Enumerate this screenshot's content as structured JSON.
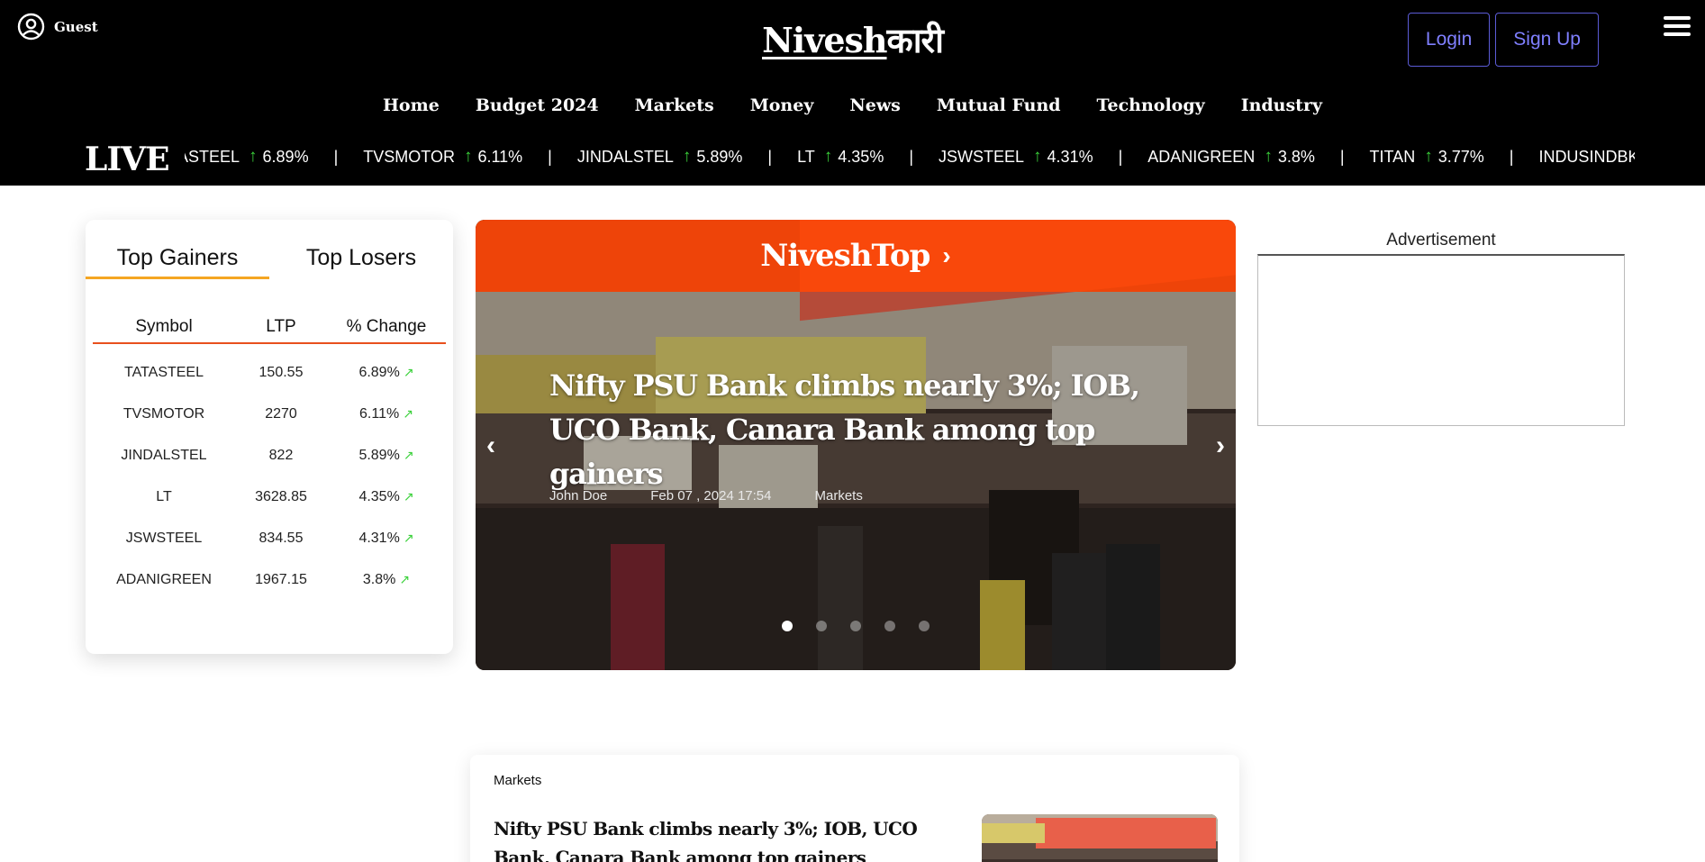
{
  "header": {
    "guest_label": "Guest",
    "logo_latin": "Nivesh",
    "logo_devanagari": "कारी",
    "login_label": "Login",
    "signup_label": "Sign Up"
  },
  "nav": {
    "items": [
      "Home",
      "Budget 2024",
      "Markets",
      "Money",
      "News",
      "Mutual Fund",
      "Technology",
      "Industry"
    ]
  },
  "ticker": {
    "live_label": "LIVE",
    "items": [
      {
        "symbol": "ASTEEL",
        "change": "6.89%"
      },
      {
        "symbol": "TVSMOTOR",
        "change": "6.11%"
      },
      {
        "symbol": "JINDALSTEL",
        "change": "5.89%"
      },
      {
        "symbol": "LT",
        "change": "4.35%"
      },
      {
        "symbol": "JSWSTEEL",
        "change": "4.31%"
      },
      {
        "symbol": "ADANIGREEN",
        "change": "3.8%"
      },
      {
        "symbol": "TITAN",
        "change": "3.77%"
      },
      {
        "symbol": "INDUSINDBK",
        "change": ""
      }
    ],
    "separator": "|"
  },
  "gainers_card": {
    "tab_gainers": "Top Gainers",
    "tab_losers": "Top Losers",
    "headers": [
      "Symbol",
      "LTP",
      "% Change"
    ],
    "rows": [
      {
        "symbol": "TATASTEEL",
        "ltp": "150.55",
        "change": "6.89%"
      },
      {
        "symbol": "TVSMOTOR",
        "ltp": "2270",
        "change": "6.11%"
      },
      {
        "symbol": "JINDALSTEL",
        "ltp": "822",
        "change": "5.89%"
      },
      {
        "symbol": "LT",
        "ltp": "3628.85",
        "change": "4.35%"
      },
      {
        "symbol": "JSWSTEEL",
        "ltp": "834.55",
        "change": "4.31%"
      },
      {
        "symbol": "ADANIGREEN",
        "ltp": "1967.15",
        "change": "3.8%"
      }
    ]
  },
  "slider": {
    "section_title": "NiveshTop",
    "headline": "Nifty PSU Bank climbs nearly 3%; IOB, UCO Bank, Canara Bank among top gainers",
    "author": "John Doe",
    "date": "Feb 07 , 2024 17:54",
    "category": "Markets",
    "slide_count": 5,
    "active_slide": 1
  },
  "ad": {
    "label": "Advertisement"
  },
  "news_card": {
    "category": "Markets",
    "title": "Nifty PSU Bank climbs nearly 3%; IOB, UCO Bank, Canara Bank among top gainers"
  },
  "colors": {
    "brand_orange": "#ff4808",
    "tab_underline": "#f5a623",
    "up_green": "#3ad13a",
    "button_border": "#5b5bd6"
  }
}
